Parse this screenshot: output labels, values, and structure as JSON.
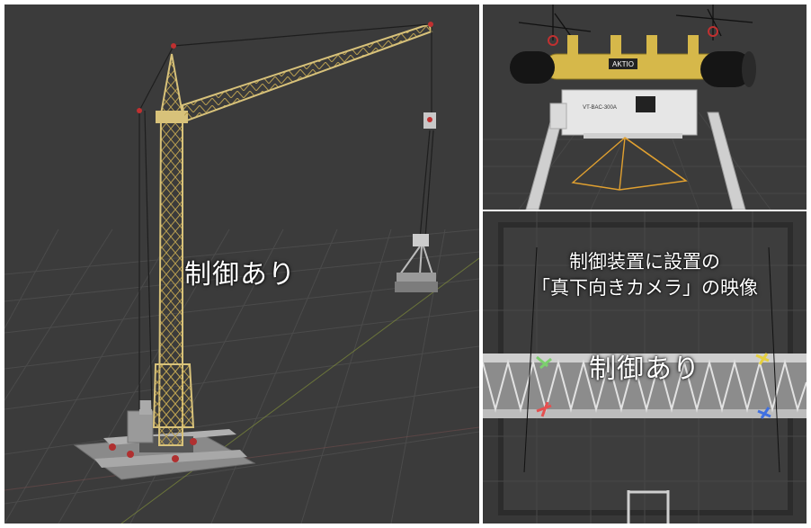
{
  "left_panel": {
    "overlay_label": "制御あり",
    "colors": {
      "background": "#3a3a3a",
      "grid": "#4a4a4a",
      "crane": "#d8c27a",
      "rope": "#222222"
    }
  },
  "top_right_panel": {
    "device_brand": "AKTIO",
    "device_label": "VT-BAC-300A"
  },
  "bottom_right_panel": {
    "caption_line1": "制御装置に設置の",
    "caption_line2": "「真下向きカメラ」の映像",
    "overlay_label": "制御あり"
  }
}
